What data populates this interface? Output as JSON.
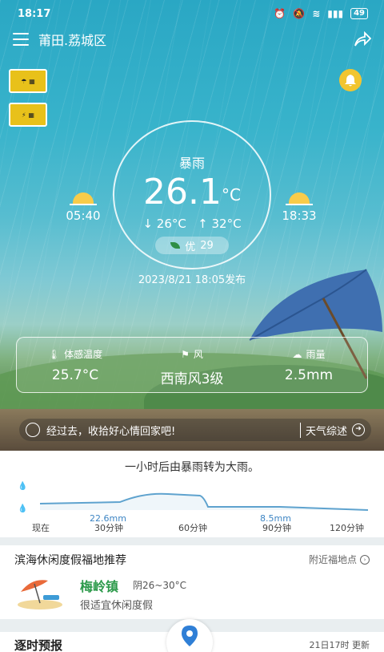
{
  "status": {
    "time": "18:17",
    "battery": "49"
  },
  "header": {
    "location": "莆田.荔城区"
  },
  "weather": {
    "condition": "暴雨",
    "temp": "26.1",
    "temp_unit": "°C",
    "low": "↓ 26°C",
    "high": "↑ 32°C",
    "aqi_label": "优",
    "aqi_value": "29",
    "published": "2023/8/21 18:05发布",
    "sunrise": "05:40",
    "sunset": "18:33"
  },
  "info": {
    "feels_label": "体感温度",
    "feels_value": "25.7°C",
    "wind_label": "风",
    "wind_value": "西南风3级",
    "rain_label": "雨量",
    "rain_value": "2.5mm"
  },
  "tip": {
    "text": "经过去，收拾好心情回家吧!",
    "button": "天气综述"
  },
  "precip": {
    "summary": "一小时后由暴雨转为大雨。",
    "labels": [
      "现在",
      "30分钟",
      "60分钟",
      "90分钟",
      "120分钟"
    ],
    "values": [
      "22.6mm",
      "8.5mm"
    ]
  },
  "promo": {
    "title": "滨海休闲度假福地推荐",
    "more": "附近福地点",
    "town": "梅岭镇",
    "town_temp": "阴26~30°C",
    "town_desc": "很适宜休闲度假"
  },
  "forecast": {
    "title": "逐时预报",
    "updated": "21日17时 更新"
  },
  "colors": {
    "accent_green": "#2d9a4b",
    "chart_blue": "#3f86c4",
    "alert_yellow": "#e8c11a"
  }
}
